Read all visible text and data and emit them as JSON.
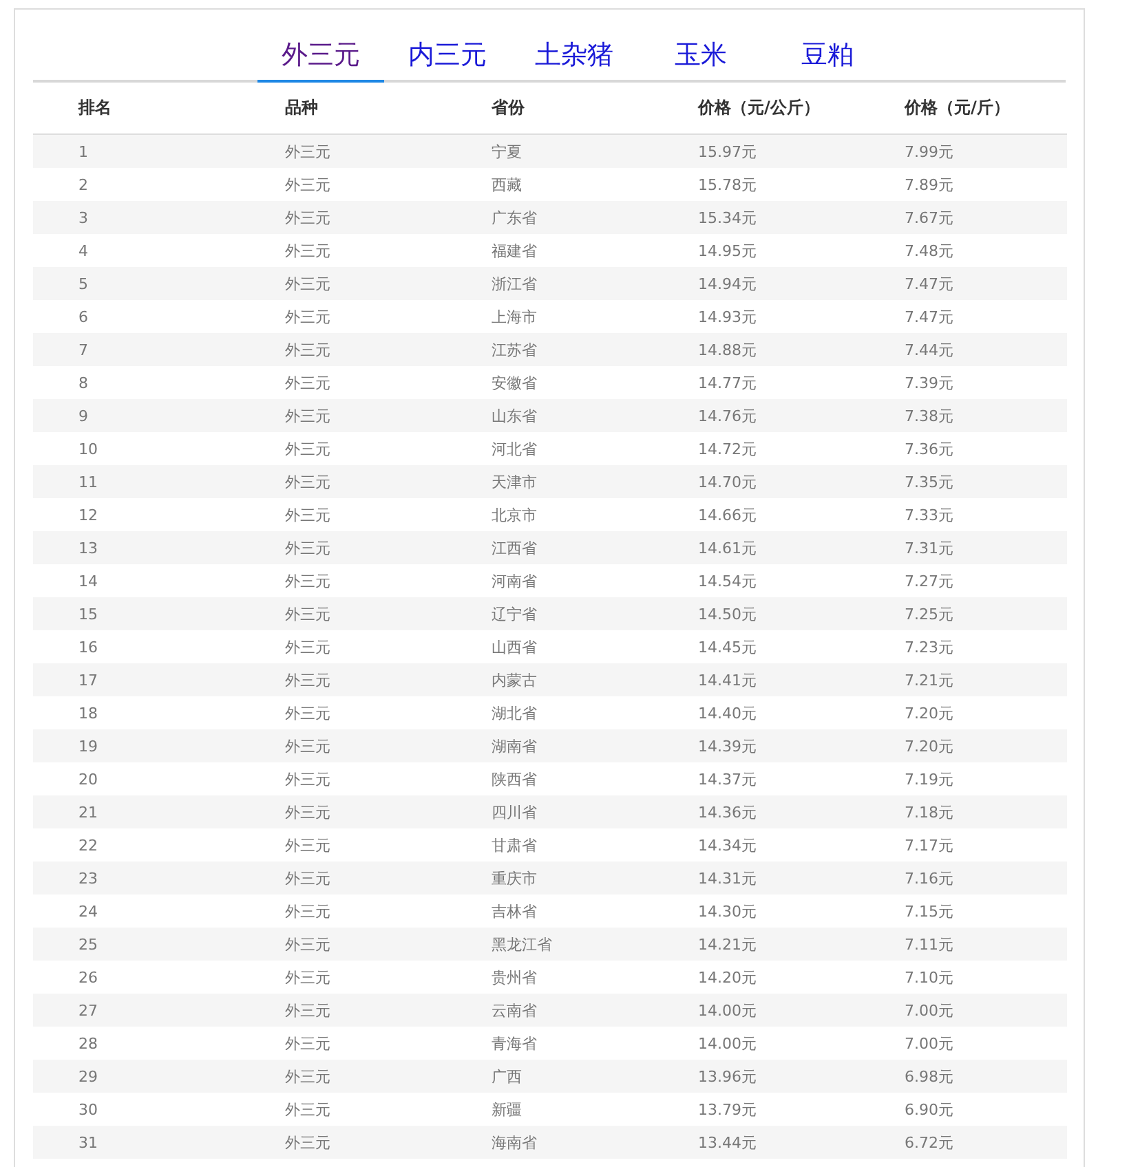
{
  "tabs": [
    {
      "label": "外三元",
      "selected": true
    },
    {
      "label": "内三元",
      "selected": false
    },
    {
      "label": "土杂猪",
      "selected": false
    },
    {
      "label": "玉米",
      "selected": false
    },
    {
      "label": "豆粕",
      "selected": false
    }
  ],
  "table": {
    "columns": [
      "排名",
      "品种",
      "省份",
      "价格（元/公斤）",
      "价格（元/斤）"
    ],
    "rows": [
      [
        "1",
        "外三元",
        "宁夏",
        "15.97元",
        "7.99元"
      ],
      [
        "2",
        "外三元",
        "西藏",
        "15.78元",
        "7.89元"
      ],
      [
        "3",
        "外三元",
        "广东省",
        "15.34元",
        "7.67元"
      ],
      [
        "4",
        "外三元",
        "福建省",
        "14.95元",
        "7.48元"
      ],
      [
        "5",
        "外三元",
        "浙江省",
        "14.94元",
        "7.47元"
      ],
      [
        "6",
        "外三元",
        "上海市",
        "14.93元",
        "7.47元"
      ],
      [
        "7",
        "外三元",
        "江苏省",
        "14.88元",
        "7.44元"
      ],
      [
        "8",
        "外三元",
        "安徽省",
        "14.77元",
        "7.39元"
      ],
      [
        "9",
        "外三元",
        "山东省",
        "14.76元",
        "7.38元"
      ],
      [
        "10",
        "外三元",
        "河北省",
        "14.72元",
        "7.36元"
      ],
      [
        "11",
        "外三元",
        "天津市",
        "14.70元",
        "7.35元"
      ],
      [
        "12",
        "外三元",
        "北京市",
        "14.66元",
        "7.33元"
      ],
      [
        "13",
        "外三元",
        "江西省",
        "14.61元",
        "7.31元"
      ],
      [
        "14",
        "外三元",
        "河南省",
        "14.54元",
        "7.27元"
      ],
      [
        "15",
        "外三元",
        "辽宁省",
        "14.50元",
        "7.25元"
      ],
      [
        "16",
        "外三元",
        "山西省",
        "14.45元",
        "7.23元"
      ],
      [
        "17",
        "外三元",
        "内蒙古",
        "14.41元",
        "7.21元"
      ],
      [
        "18",
        "外三元",
        "湖北省",
        "14.40元",
        "7.20元"
      ],
      [
        "19",
        "外三元",
        "湖南省",
        "14.39元",
        "7.20元"
      ],
      [
        "20",
        "外三元",
        "陕西省",
        "14.37元",
        "7.19元"
      ],
      [
        "21",
        "外三元",
        "四川省",
        "14.36元",
        "7.18元"
      ],
      [
        "22",
        "外三元",
        "甘肃省",
        "14.34元",
        "7.17元"
      ],
      [
        "23",
        "外三元",
        "重庆市",
        "14.31元",
        "7.16元"
      ],
      [
        "24",
        "外三元",
        "吉林省",
        "14.30元",
        "7.15元"
      ],
      [
        "25",
        "外三元",
        "黑龙江省",
        "14.21元",
        "7.11元"
      ],
      [
        "26",
        "外三元",
        "贵州省",
        "14.20元",
        "7.10元"
      ],
      [
        "27",
        "外三元",
        "云南省",
        "14.00元",
        "7.00元"
      ],
      [
        "28",
        "外三元",
        "青海省",
        "14.00元",
        "7.00元"
      ],
      [
        "29",
        "外三元",
        "广西",
        "13.96元",
        "6.98元"
      ],
      [
        "30",
        "外三元",
        "新疆",
        "13.79元",
        "6.90元"
      ],
      [
        "31",
        "外三元",
        "海南省",
        "13.44元",
        "6.72元"
      ]
    ]
  }
}
